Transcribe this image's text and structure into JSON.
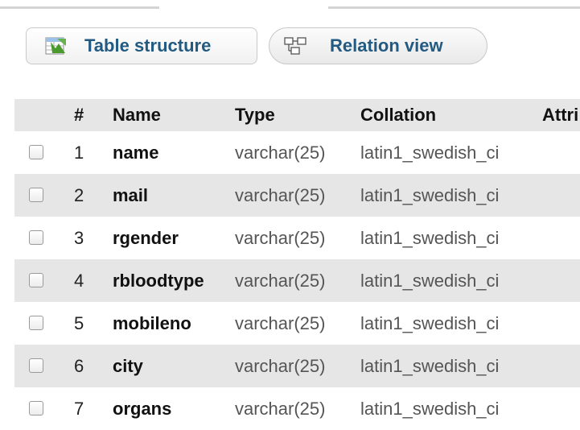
{
  "tabs": {
    "structure_label": "Table structure",
    "relation_label": "Relation view"
  },
  "columns": {
    "num": "#",
    "name": "Name",
    "type": "Type",
    "collation": "Collation",
    "attributes": "Attri"
  },
  "rows": [
    {
      "num": "1",
      "name": "name",
      "type": "varchar(25)",
      "collation": "latin1_swedish_ci"
    },
    {
      "num": "2",
      "name": "mail",
      "type": "varchar(25)",
      "collation": "latin1_swedish_ci"
    },
    {
      "num": "3",
      "name": "rgender",
      "type": "varchar(25)",
      "collation": "latin1_swedish_ci"
    },
    {
      "num": "4",
      "name": "rbloodtype",
      "type": "varchar(25)",
      "collation": "latin1_swedish_ci"
    },
    {
      "num": "5",
      "name": "mobileno",
      "type": "varchar(25)",
      "collation": "latin1_swedish_ci"
    },
    {
      "num": "6",
      "name": "city",
      "type": "varchar(25)",
      "collation": "latin1_swedish_ci"
    },
    {
      "num": "7",
      "name": "organs",
      "type": "varchar(25)",
      "collation": "latin1_swedish_ci"
    }
  ],
  "colors": {
    "link": "#235a81",
    "row_alt": "#e6e6e6",
    "muted_text": "#555555"
  }
}
